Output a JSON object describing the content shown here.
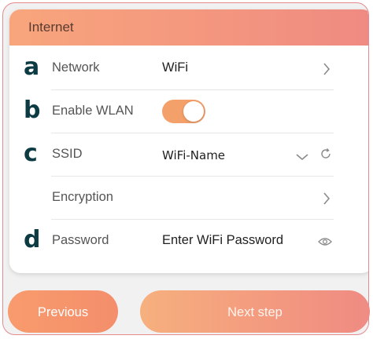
{
  "header": {
    "title": "Internet"
  },
  "rows": [
    {
      "marker": "a",
      "label": "Network",
      "value": "WiFi"
    },
    {
      "marker": "b",
      "label": "Enable WLAN",
      "toggle_on": true
    },
    {
      "marker": "c",
      "label": "SSID",
      "value": "WiFi-Name"
    },
    {
      "marker": "",
      "label": "Encryption",
      "value": ""
    },
    {
      "marker": "d",
      "label": "Password",
      "placeholder": "Enter WiFi Password"
    }
  ],
  "buttons": {
    "previous": "Previous",
    "next": "Next step"
  },
  "colors": {
    "accent": "#f4a06a",
    "marker": "#0d3b44",
    "frame_border": "#e58a8e"
  },
  "icons": [
    "chevron-right-icon",
    "chevron-down-icon",
    "refresh-icon",
    "eye-icon"
  ]
}
